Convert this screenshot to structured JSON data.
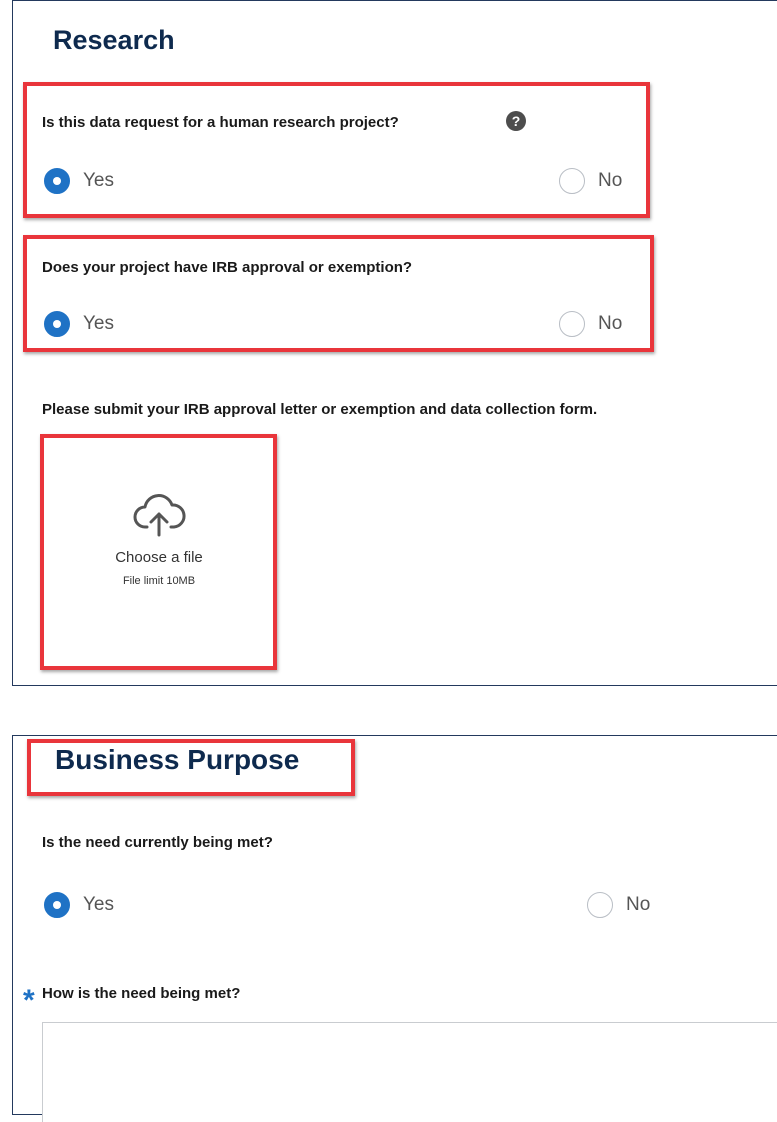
{
  "research": {
    "title": "Research",
    "q1": {
      "label": "Is this data request for a human research project?",
      "help_icon": "?",
      "yes": "Yes",
      "no": "No",
      "selected": "Yes"
    },
    "q2": {
      "label": "Does your project have IRB approval or exemption?",
      "yes": "Yes",
      "no": "No",
      "selected": "Yes"
    },
    "upload_prompt": "Please submit your IRB approval letter or exemption and data collection form.",
    "upload": {
      "icon": "cloud-upload-icon",
      "label": "Choose a file",
      "limit": "File limit 10MB"
    }
  },
  "business": {
    "title": "Business Purpose",
    "q1": {
      "label": "Is the need currently being met?",
      "yes": "Yes",
      "no": "No",
      "selected": "Yes"
    },
    "q2": {
      "required_mark": "*",
      "label": "How is the need being met?",
      "value": ""
    }
  },
  "colors": {
    "accent": "#1f72c5",
    "highlight": "#e9353b",
    "heading": "#0e2a4e",
    "panel_border": "#23395d"
  }
}
